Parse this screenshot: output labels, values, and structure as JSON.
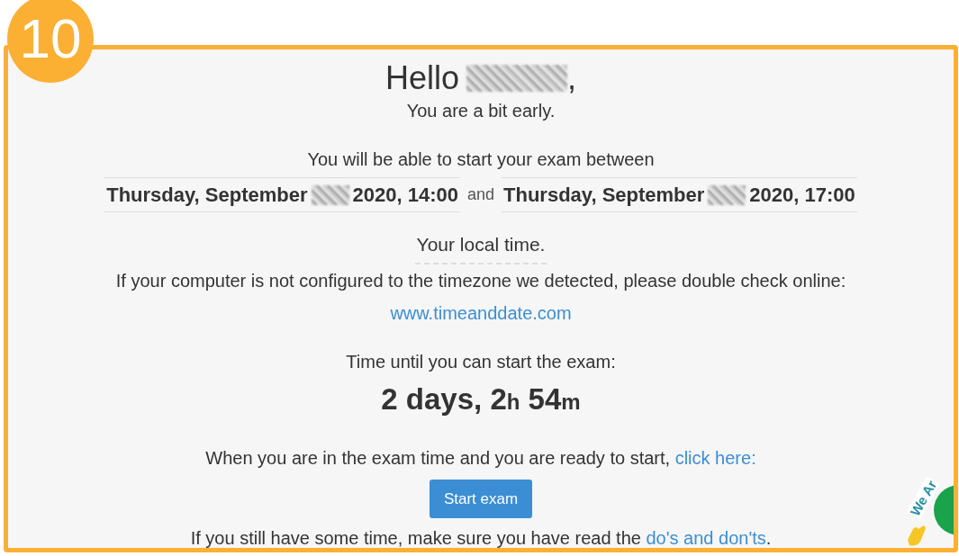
{
  "step_badge": "10",
  "greeting": {
    "text": "Hello",
    "name_redacted": true,
    "suffix": ","
  },
  "status_line": "You are a bit early.",
  "window_intro": "You will be able to start your exam between",
  "window": {
    "start": {
      "before": "Thursday, September",
      "after": "2020, 14:00",
      "day_redacted": true
    },
    "joiner": "and",
    "end": {
      "before": "Thursday, September",
      "after": "2020, 17:00",
      "day_redacted": true
    }
  },
  "local_time": "Your local time.",
  "timezone_notice": "If your computer is not configured to the timezone we detected, please double check online:",
  "timezone_link": "www.timeanddate.com",
  "countdown_label": "Time until you can start the exam:",
  "countdown": [
    {
      "kind": "number",
      "text": "2 days, 2"
    },
    {
      "kind": "unit",
      "text": "h"
    },
    {
      "kind": "number",
      "text": " 54"
    },
    {
      "kind": "unit",
      "text": "m"
    }
  ],
  "ready_text": "When you are in the exam time and you are ready to start,",
  "ready_link": "click here:",
  "start_button": "Start exam",
  "reminder": {
    "text": "If you still have some time, make sure you have read the",
    "link": "do's and don'ts",
    "end": "."
  },
  "chat_widget": {
    "text": "We Ar"
  }
}
